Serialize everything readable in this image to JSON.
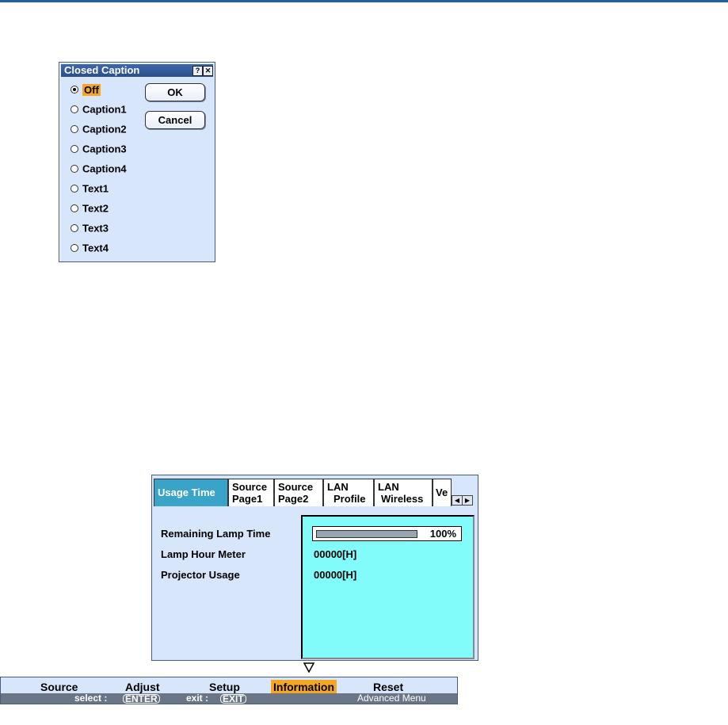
{
  "closed_caption": {
    "title": "Closed Caption",
    "help_glyph": "?",
    "close_glyph": "✕",
    "options": [
      "Off",
      "Caption1",
      "Caption2",
      "Caption3",
      "Caption4",
      "Text1",
      "Text2",
      "Text3",
      "Text4"
    ],
    "selected": "Off",
    "ok_label": "OK",
    "cancel_label": "Cancel"
  },
  "info_panel": {
    "tabs": [
      {
        "line1": "Usage Time",
        "line2": ""
      },
      {
        "line1": "Source",
        "line2": "Page1"
      },
      {
        "line1": "Source",
        "line2": "Page2"
      },
      {
        "line1": "LAN",
        "line2": "Profile"
      },
      {
        "line1": "LAN",
        "line2": "Wireless"
      },
      {
        "line1": "Ve",
        "line2": ""
      }
    ],
    "active_tab": "Usage Time",
    "rows": [
      {
        "label": "Remaining Lamp Time",
        "value": "100%"
      },
      {
        "label": "Lamp Hour Meter",
        "value": "00000[H]"
      },
      {
        "label": "Projector Usage",
        "value": "00000[H]"
      }
    ],
    "lamp_remaining_percent": 100,
    "scroll_left_glyph": "◀",
    "scroll_right_glyph": "▶"
  },
  "menu": {
    "items": [
      "Source",
      "Adjust",
      "Setup",
      "Information",
      "Reset"
    ],
    "selected": "Information",
    "select_text": "select :",
    "enter_key": "ENTER",
    "exit_text": "exit :",
    "exit_key": "EXIT",
    "mode_label": "Advanced Menu"
  },
  "colors": {
    "panel_bg": "#d8e6fb",
    "highlight": "#f5a623",
    "active_tab": "#3aa3c8",
    "content_pane": "#82fbfb",
    "title_bar": "#2a4f8c",
    "status_bar": "#6a7586"
  },
  "icons": {
    "down_arrow": "down-triangle-icon"
  }
}
